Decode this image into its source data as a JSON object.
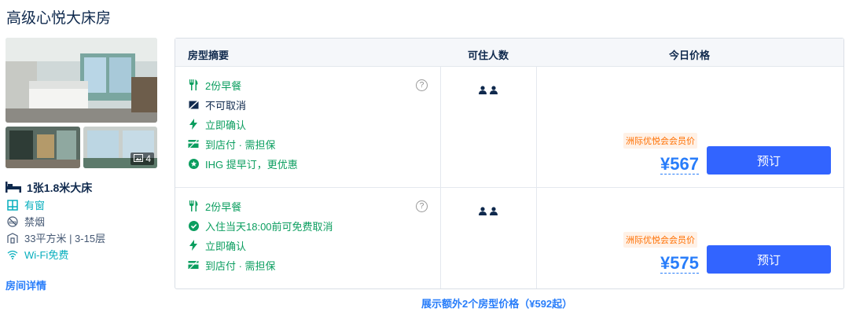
{
  "room": {
    "title": "高级心悦大床房",
    "photo_count": "4",
    "bed": "1张1.8米大床",
    "facts": [
      {
        "icon": "window-icon",
        "text": "有窗",
        "highlight": true
      },
      {
        "icon": "no-smoking-icon",
        "text": "禁烟",
        "highlight": false
      },
      {
        "icon": "area-icon",
        "text": "33平方米 | 3-15层",
        "highlight": false
      },
      {
        "icon": "wifi-icon",
        "text": "Wi-Fi免费",
        "highlight": true
      }
    ],
    "detail_link": "房间详情"
  },
  "table": {
    "headers": {
      "summary": "房型摘要",
      "guests": "可住人数",
      "price": "今日价格"
    },
    "rates": [
      {
        "perks": [
          {
            "icon": "breakfast-icon",
            "text": "2份早餐",
            "color": "green"
          },
          {
            "icon": "no-cancel-icon",
            "text": "不可取消",
            "color": "dark"
          },
          {
            "icon": "lightning-icon",
            "text": "立即确认",
            "color": "green"
          },
          {
            "icon": "pay-at-hotel-icon",
            "text": "到店付 · 需担保",
            "color": "green"
          },
          {
            "icon": "star-badge-icon",
            "text": "IHG 提早订，更优惠",
            "color": "green"
          }
        ],
        "help": "?",
        "member_badge": "洲际优悦会会员价",
        "price": "¥567",
        "book_label": "预订"
      },
      {
        "perks": [
          {
            "icon": "breakfast-icon",
            "text": "2份早餐",
            "color": "green"
          },
          {
            "icon": "check-circle-icon",
            "text": "入住当天18:00前可免费取消",
            "color": "green"
          },
          {
            "icon": "lightning-icon",
            "text": "立即确认",
            "color": "green"
          },
          {
            "icon": "pay-at-hotel-icon",
            "text": "到店付 · 需担保",
            "color": "green"
          }
        ],
        "help": "?",
        "member_badge": "洲际优悦会会员价",
        "price": "¥575",
        "book_label": "预订"
      }
    ],
    "more_link": "展示额外2个房型价格（¥592起）"
  },
  "colors": {
    "accent": "#3264ff",
    "link": "#287dfa",
    "green": "#0b9e5f",
    "badge": "#ff6f00"
  }
}
